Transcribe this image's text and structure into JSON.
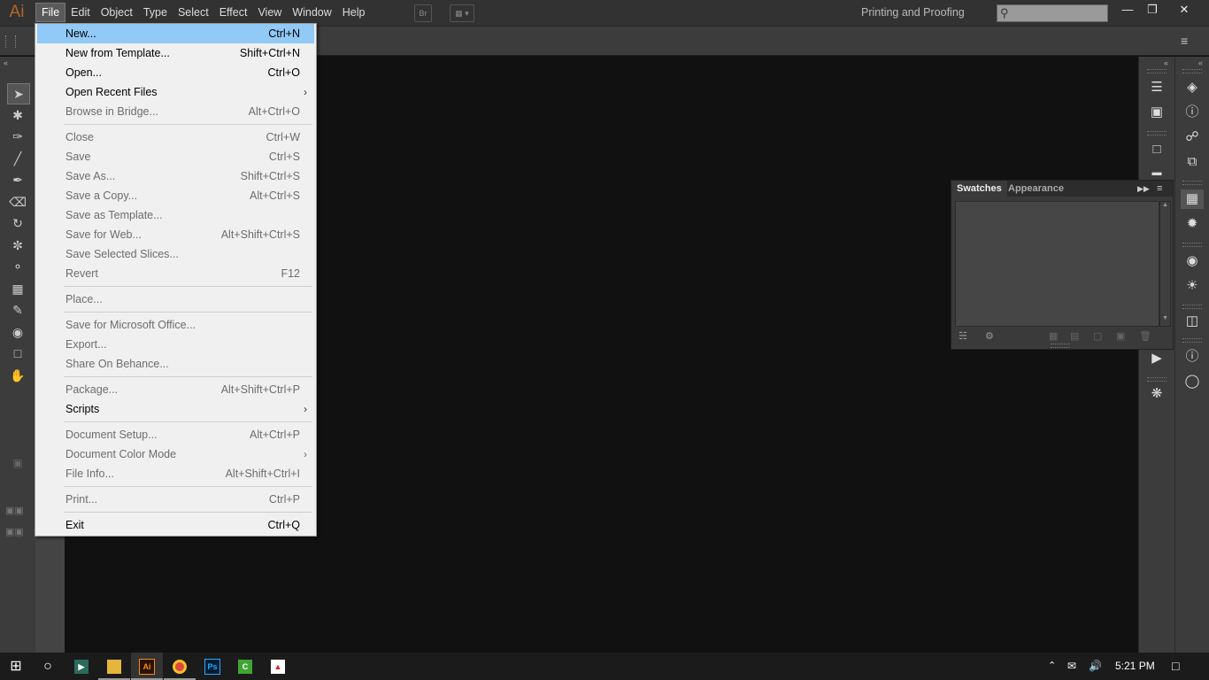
{
  "app": {
    "logo": "Ai",
    "colors": {
      "accent": "#b4652a",
      "menu_highlight": "#91c9f7",
      "canvas": "#111111"
    }
  },
  "menubar": {
    "items": [
      "File",
      "Edit",
      "Object",
      "Type",
      "Select",
      "Effect",
      "View",
      "Window",
      "Help"
    ],
    "bridge": "Br",
    "arrange_icon": "arrange-documents-icon",
    "workspace": "Printing and Proofing",
    "window_buttons": {
      "minimize": "—",
      "restore": "❐",
      "close": "✕"
    }
  },
  "file_menu": {
    "sections": [
      [
        {
          "label": "New...",
          "shortcut": "Ctrl+N",
          "enabled": true,
          "highlighted": true
        },
        {
          "label": "New from Template...",
          "shortcut": "Shift+Ctrl+N",
          "enabled": true
        },
        {
          "label": "Open...",
          "shortcut": "Ctrl+O",
          "enabled": true
        },
        {
          "label": "Open Recent Files",
          "shortcut": "",
          "enabled": true,
          "submenu": true
        },
        {
          "label": "Browse in Bridge...",
          "shortcut": "Alt+Ctrl+O",
          "enabled": false
        }
      ],
      [
        {
          "label": "Close",
          "shortcut": "Ctrl+W",
          "enabled": false
        },
        {
          "label": "Save",
          "shortcut": "Ctrl+S",
          "enabled": false
        },
        {
          "label": "Save As...",
          "shortcut": "Shift+Ctrl+S",
          "enabled": false
        },
        {
          "label": "Save a Copy...",
          "shortcut": "Alt+Ctrl+S",
          "enabled": false
        },
        {
          "label": "Save as Template...",
          "shortcut": "",
          "enabled": false
        },
        {
          "label": "Save for Web...",
          "shortcut": "Alt+Shift+Ctrl+S",
          "enabled": false
        },
        {
          "label": "Save Selected Slices...",
          "shortcut": "",
          "enabled": false
        },
        {
          "label": "Revert",
          "shortcut": "F12",
          "enabled": false
        }
      ],
      [
        {
          "label": "Place...",
          "shortcut": "",
          "enabled": false
        }
      ],
      [
        {
          "label": "Save for Microsoft Office...",
          "shortcut": "",
          "enabled": false
        },
        {
          "label": "Export...",
          "shortcut": "",
          "enabled": false
        },
        {
          "label": "Share On Behance...",
          "shortcut": "",
          "enabled": false
        }
      ],
      [
        {
          "label": "Package...",
          "shortcut": "Alt+Shift+Ctrl+P",
          "enabled": false
        },
        {
          "label": "Scripts",
          "shortcut": "",
          "enabled": true,
          "submenu": true
        }
      ],
      [
        {
          "label": "Document Setup...",
          "shortcut": "Alt+Ctrl+P",
          "enabled": false
        },
        {
          "label": "Document Color Mode",
          "shortcut": "",
          "enabled": false,
          "submenu": true
        },
        {
          "label": "File Info...",
          "shortcut": "Alt+Shift+Ctrl+I",
          "enabled": false
        }
      ],
      [
        {
          "label": "Print...",
          "shortcut": "Ctrl+P",
          "enabled": false
        }
      ],
      [
        {
          "label": "Exit",
          "shortcut": "Ctrl+Q",
          "enabled": true
        }
      ]
    ]
  },
  "swatches_panel": {
    "tabs": [
      "Swatches",
      "Appearance"
    ],
    "active_tab": "Swatches"
  },
  "tools": [
    "selection-tool-icon",
    "magic-wand-icon",
    "pen-tool-icon",
    "line-tool-icon",
    "paintbrush-icon",
    "eraser-icon",
    "rotate-tool-icon",
    "width-tool-icon",
    "shape-builder-icon",
    "perspective-grid-icon",
    "eyedropper-icon",
    "symbol-sprayer-icon",
    "artboard-tool-icon",
    "hand-tool-icon"
  ],
  "taskbar": {
    "apps": [
      "start-icon",
      "cortana-icon",
      "app-icon",
      "file-explorer-icon",
      "illustrator-icon",
      "chrome-icon",
      "photoshop-icon",
      "camtasia-icon",
      "acrobat-icon"
    ],
    "illustrator_label": "Ai",
    "photoshop_label": "Ps",
    "camtasia_label": "C",
    "time": "5:21 PM"
  }
}
